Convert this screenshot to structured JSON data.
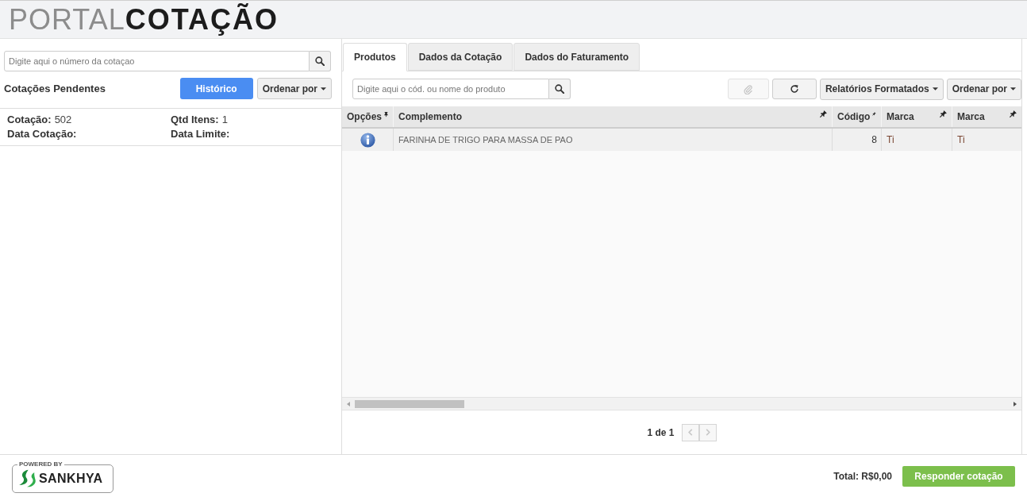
{
  "header": {
    "logo": "PORTAL**COTAÇÃO**"
  },
  "left_panel": {
    "search": {
      "placeholder": "Digite aqui o número da cotaçao"
    },
    "title": "Cotações Pendentes",
    "buttons": [
      {
        "kind": "primary",
        "label": "Histórico"
      },
      {
        "kind": "dropdown",
        "label": "Ordenar por"
      }
    ],
    "quotes": [
      {
        "fields": [
          {
            "label": "Cotação:",
            "value": "502"
          },
          {
            "label": "Qtd Itens:",
            "value": "1"
          },
          {
            "label": "Data Cotação:"
          },
          {
            "label": "Data Limite:"
          }
        ]
      }
    ]
  },
  "right_panel": {
    "tabs": [
      {
        "label": "Produtos",
        "selected": true
      },
      {
        "label": "Dados da Cotação",
        "selected": false
      },
      {
        "label": "Dados do Faturamento",
        "selected": false
      }
    ],
    "search": {
      "placeholder": "Digite aqui o cód. ou nome do produto"
    },
    "toolbar": [
      {
        "kind": "attach",
        "disabled": true
      },
      {
        "kind": "refresh",
        "disabled": false
      },
      {
        "kind": "dropdown",
        "label": "Relatórios Formatados"
      },
      {
        "kind": "dropdown",
        "label": "Ordenar por"
      }
    ],
    "table": {
      "columns": [
        {
          "kind": "icon",
          "label": "Opções",
          "pinned": true
        },
        {
          "kind": "text",
          "label": "Complemento",
          "pinned": false
        },
        {
          "kind": "number",
          "label": "Código",
          "pinned": false
        },
        {
          "kind": "text",
          "label": "Marca",
          "pinned": false
        },
        {
          "kind": "text",
          "label": "Marca",
          "pinned": false
        }
      ],
      "rows": [
        {
          "cells": [
            {
              "kind": "info"
            },
            {
              "kind": "text",
              "text": "FARINHA DE TRIGO PARA MASSA DE PAO"
            },
            {
              "kind": "number",
              "text": "8"
            },
            {
              "kind": "editable",
              "text": "Ti"
            },
            {
              "kind": "editable",
              "text": "Ti"
            }
          ]
        }
      ]
    },
    "pagination": {
      "text": "1 de 1",
      "buttons": [
        {
          "kind": "prev",
          "disabled": true
        },
        {
          "kind": "next",
          "disabled": true
        }
      ]
    }
  },
  "footer": {
    "brand": {
      "caption": "POWERED BY",
      "name": "SANKHYA"
    },
    "total": "Total: R$0,00",
    "button": "Responder cotação"
  }
}
